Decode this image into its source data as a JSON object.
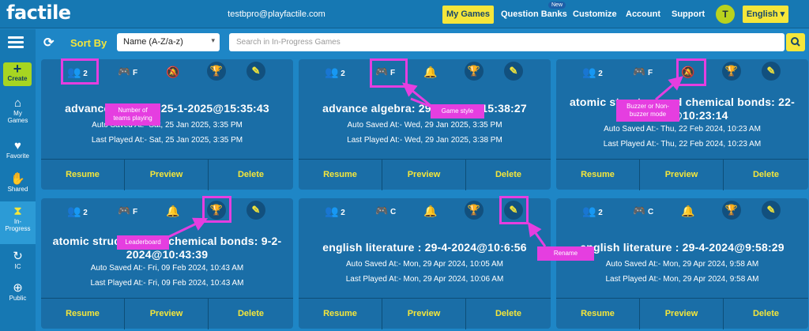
{
  "header": {
    "logo": "factile",
    "email": "testbpro@playfactile.com",
    "nav": [
      "My Games",
      "Question Banks",
      "Customize",
      "Account",
      "Support"
    ],
    "new_badge": "New",
    "avatar": "T",
    "language": "English"
  },
  "sidebar": {
    "create": "Create",
    "items": [
      {
        "label1": "My",
        "label2": "Games",
        "icon": "home-icon"
      },
      {
        "label1": "Favorite",
        "label2": "",
        "icon": "heart-icon"
      },
      {
        "label1": "Shared",
        "label2": "",
        "icon": "handshake-icon"
      },
      {
        "label1": "In-",
        "label2": "Progress",
        "icon": "hourglass-icon"
      },
      {
        "label1": "IC",
        "label2": "",
        "icon": "ic-icon"
      },
      {
        "label1": "Public",
        "label2": "",
        "icon": "globe-icon"
      }
    ]
  },
  "toolbar": {
    "sort_label": "Sort By",
    "sort_value": "Name (A-Z/a-z)",
    "search_placeholder": "Search in In-Progress Games"
  },
  "cards": [
    {
      "teams": "2",
      "style": "F",
      "title1": "advance algebra: 25-1-2025@15:35:43",
      "title2": "",
      "saved": "Auto Saved At:- Sat, 25 Jan 2025, 3:35 PM",
      "played": "Last Played At:- Sat, 25 Jan 2025, 3:35 PM"
    },
    {
      "teams": "2",
      "style": "F",
      "title1": "advance algebra: 29-1-2025@15:38:27",
      "title2": "",
      "saved": "Auto Saved At:- Wed, 29 Jan 2025, 3:35 PM",
      "played": "Last Played At:- Wed, 29 Jan 2025, 3:38 PM"
    },
    {
      "teams": "2",
      "style": "F",
      "title1": "atomic structure and chemical bonds: 22-",
      "title2": "2-2024@10:23:14",
      "saved": "Auto Saved At:- Thu, 22 Feb 2024, 10:23 AM",
      "played": "Last Played At:- Thu, 22 Feb 2024, 10:23 AM"
    },
    {
      "teams": "2",
      "style": "F",
      "title1": "atomic structure and chemical bonds: 9-2-",
      "title2": "2024@10:43:39",
      "saved": "Auto Saved At:- Fri, 09 Feb 2024, 10:43 AM",
      "played": "Last Played At:- Fri, 09 Feb 2024, 10:43 AM"
    },
    {
      "teams": "2",
      "style": "C",
      "title1": "english literature : 29-4-2024@10:6:56",
      "title2": "",
      "saved": "Auto Saved At:- Mon, 29 Apr 2024, 10:05 AM",
      "played": "Last Played At:- Mon, 29 Apr 2024, 10:06 AM"
    },
    {
      "teams": "2",
      "style": "C",
      "title1": "english literature : 29-4-2024@9:58:29",
      "title2": "",
      "saved": "Auto Saved At:- Mon, 29 Apr 2024, 9:58 AM",
      "played": "Last Played At:- Mon, 29 Apr 2024, 9:58 AM"
    }
  ],
  "card_buttons": {
    "resume": "Resume",
    "preview": "Preview",
    "delete": "Delete"
  },
  "callouts": {
    "teams": "Number of teams playing",
    "style": "Game style",
    "buzzer": "Buzzer or Non-buzzer mode",
    "leaderboard": "Leaderboard",
    "rename": "Rename"
  },
  "colors": {
    "accent": "#f5e63a",
    "callout": "#e53ee0",
    "card": "#1a6ea7"
  }
}
